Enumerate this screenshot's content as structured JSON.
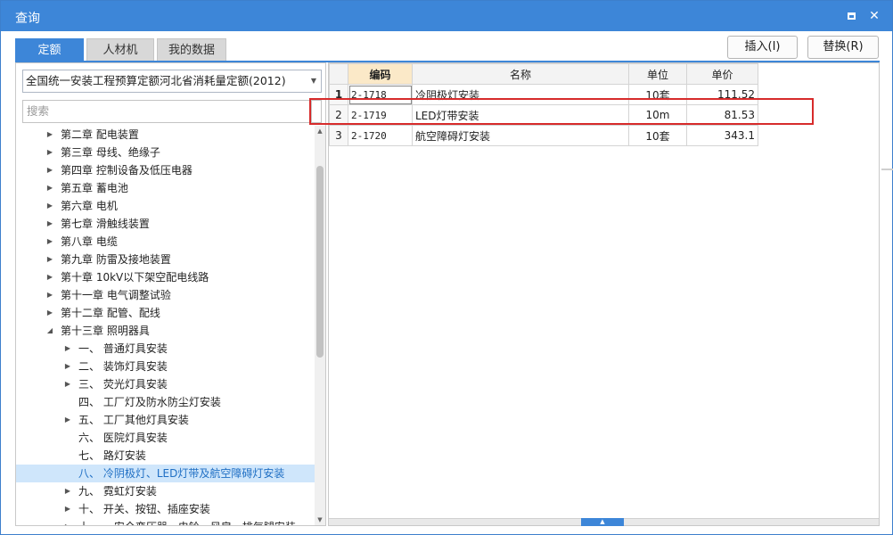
{
  "window": {
    "title": "查询"
  },
  "tabs": [
    {
      "label": "定额",
      "active": true
    },
    {
      "label": "人材机",
      "active": false
    },
    {
      "label": "我的数据",
      "active": false
    }
  ],
  "actions": {
    "insert_label": "插入(I)",
    "replace_label": "替换(R)"
  },
  "library": {
    "selected": "全国统一安装工程预算定额河北省消耗量定额(2012)"
  },
  "search": {
    "placeholder": "搜索"
  },
  "tree": [
    {
      "label": "第二章 配电装置",
      "level": 0,
      "arrow": "collapsed"
    },
    {
      "label": "第三章 母线、绝缘子",
      "level": 0,
      "arrow": "collapsed"
    },
    {
      "label": "第四章 控制设备及低压电器",
      "level": 0,
      "arrow": "collapsed"
    },
    {
      "label": "第五章 蓄电池",
      "level": 0,
      "arrow": "collapsed"
    },
    {
      "label": "第六章 电机",
      "level": 0,
      "arrow": "collapsed"
    },
    {
      "label": "第七章 滑触线装置",
      "level": 0,
      "arrow": "collapsed"
    },
    {
      "label": "第八章 电缆",
      "level": 0,
      "arrow": "collapsed"
    },
    {
      "label": "第九章 防雷及接地装置",
      "level": 0,
      "arrow": "collapsed"
    },
    {
      "label": "第十章 10kV以下架空配电线路",
      "level": 0,
      "arrow": "collapsed"
    },
    {
      "label": "第十一章 电气调整试验",
      "level": 0,
      "arrow": "collapsed"
    },
    {
      "label": "第十二章 配管、配线",
      "level": 0,
      "arrow": "collapsed"
    },
    {
      "label": "第十三章 照明器具",
      "level": 0,
      "arrow": "expanded"
    },
    {
      "label": "一、 普通灯具安装",
      "level": 1,
      "arrow": "collapsed"
    },
    {
      "label": "二、 装饰灯具安装",
      "level": 1,
      "arrow": "collapsed"
    },
    {
      "label": "三、 荧光灯具安装",
      "level": 1,
      "arrow": "collapsed"
    },
    {
      "label": "四、 工厂灯及防水防尘灯安装",
      "level": 1,
      "arrow": "none"
    },
    {
      "label": "五、 工厂其他灯具安装",
      "level": 1,
      "arrow": "collapsed"
    },
    {
      "label": "六、 医院灯具安装",
      "level": 1,
      "arrow": "none"
    },
    {
      "label": "七、 路灯安装",
      "level": 1,
      "arrow": "none"
    },
    {
      "label": "八、 冷阴极灯、LED灯带及航空障碍灯安装",
      "level": 1,
      "arrow": "none",
      "selected": true
    },
    {
      "label": "九、 霓虹灯安装",
      "level": 1,
      "arrow": "collapsed"
    },
    {
      "label": "十、 开关、按钮、插座安装",
      "level": 1,
      "arrow": "collapsed"
    },
    {
      "label": "十一、 安全变压器、电铃、风扇、排气腿安装",
      "level": 1,
      "arrow": "collapsed"
    }
  ],
  "table": {
    "columns": [
      "编码",
      "名称",
      "单位",
      "单价"
    ],
    "rows": [
      {
        "num": "1",
        "code": "2-1718",
        "name": "冷阴极灯安装",
        "unit": "10套",
        "price": "111.52"
      },
      {
        "num": "2",
        "code": "2-1719",
        "name": "LED灯带安装",
        "unit": "10m",
        "price": "81.53"
      },
      {
        "num": "3",
        "code": "2-1720",
        "name": "航空障碍灯安装",
        "unit": "10套",
        "price": "343.1"
      }
    ]
  },
  "colors": {
    "accent": "#3d86d8",
    "highlight_box": "#d72b2b",
    "selected_row": "#cfe6fb"
  },
  "icons": {
    "maximize": "maximize-icon",
    "close": "close-icon",
    "dropdown": "chevron-down-icon"
  }
}
